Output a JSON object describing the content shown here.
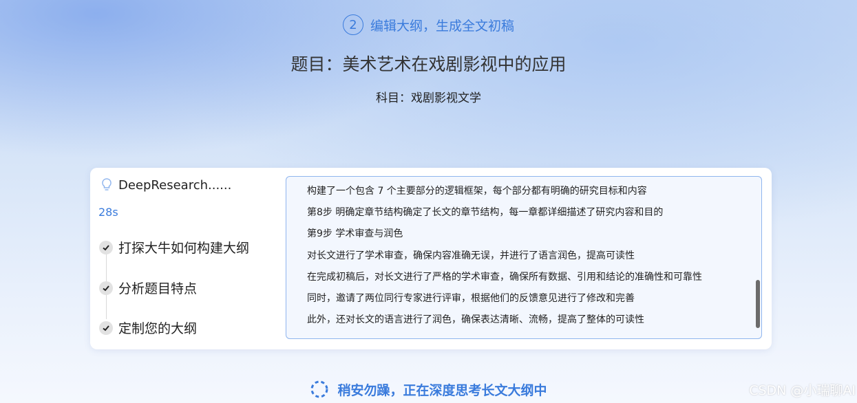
{
  "header": {
    "step_number": "2",
    "step_label": "编辑大纲，生成全文初稿",
    "title": "题目：美术艺术在戏剧影视中的应用",
    "subject": "科目：戏剧影视文学"
  },
  "panel": {
    "research_label": "DeepResearch......",
    "elapsed": "28s",
    "steps": [
      {
        "label": "打探大牛如何构建大纲"
      },
      {
        "label": "分析题目特点"
      },
      {
        "label": "定制您的大纲"
      }
    ],
    "log_lines": [
      "构建了一个包含 7 个主要部分的逻辑框架，每个部分都有明确的研究目标和内容",
      "第8步 明确定章节结构确定了长文的章节结构，每一章都详细描述了研究内容和目的",
      "第9步 学术审查与润色",
      "对长文进行了学术审查，确保内容准确无误，并进行了语言润色，提高可读性",
      "在完成初稿后，对长文进行了严格的学术审查，确保所有数据、引用和结论的准确性和可靠性",
      "同时，邀请了两位同行专家进行评审，根据他们的反馈意见进行了修改和完善",
      "此外，还对长文的语言进行了润色，确保表达清晰、流畅，提高了整体的可读性",
      "..."
    ]
  },
  "status": {
    "thinking": "稍安勿躁，正在深度思考长文大纲中"
  },
  "watermark": "CSDN @小瑞聊AI",
  "colors": {
    "accent": "#3a7bdc"
  }
}
